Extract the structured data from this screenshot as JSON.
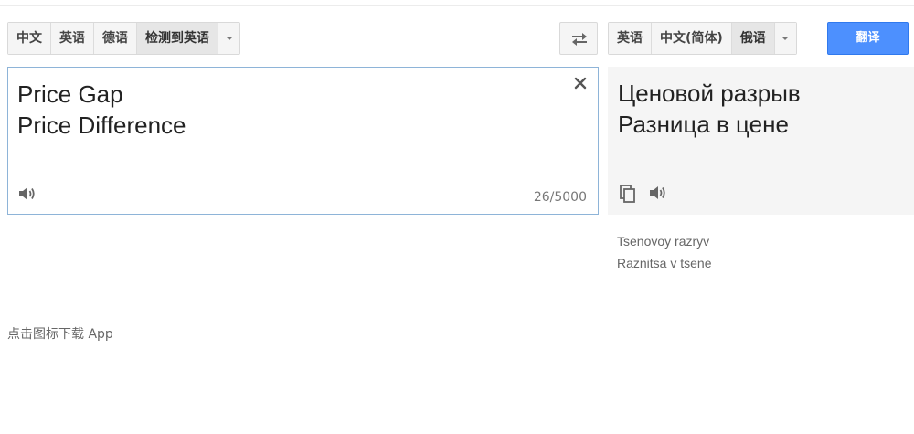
{
  "source_languages": {
    "buttons": [
      "中文",
      "英语",
      "德语",
      "检测到英语"
    ],
    "selected_index": 3
  },
  "target_languages": {
    "buttons": [
      "英语",
      "中文(简体)",
      "俄语"
    ],
    "selected_index": 2
  },
  "translate_button": "翻译",
  "source": {
    "text": "Price Gap\nPrice Difference",
    "char_count": "26/5000"
  },
  "target": {
    "text": "Ценовой разрыв\nРазница в цене",
    "transliteration": "Tsenovoy razryv\nRaznitsa v tsene"
  },
  "footer": {
    "app_link": "点击图标下载 App"
  },
  "icons": {
    "swap": "swap-arrows-icon",
    "clear": "close-icon",
    "speaker": "speaker-icon",
    "copy": "copy-icon",
    "dropdown": "chevron-down-icon"
  },
  "colors": {
    "accent": "#4d90fe",
    "panel_border": "#8eb4d8",
    "target_bg": "#f5f5f5"
  }
}
